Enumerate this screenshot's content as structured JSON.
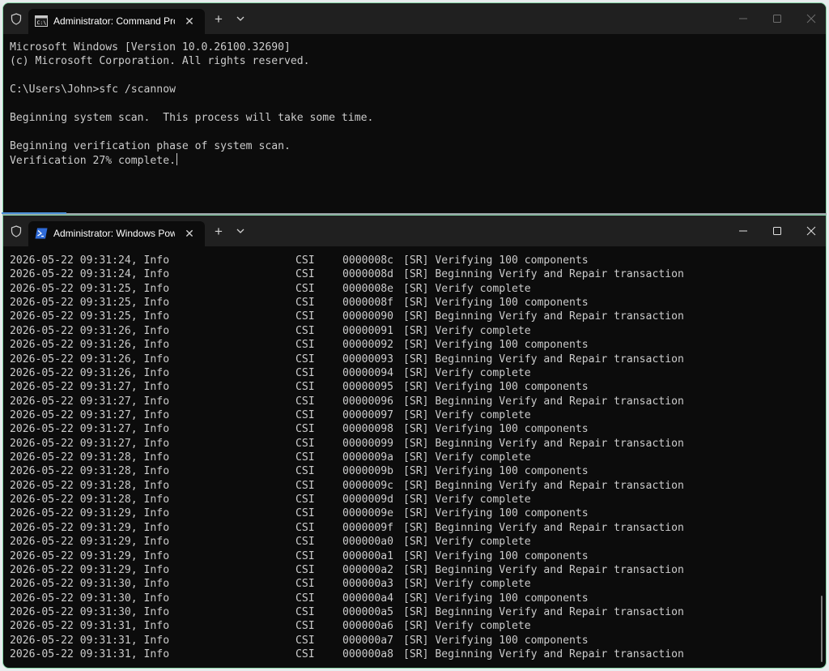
{
  "top_pane": {
    "tab_title": "Administrator: Command Prompt",
    "tab_icon": "command-prompt-icon",
    "lines": [
      "Microsoft Windows [Version 10.0.26100.32690]",
      "(c) Microsoft Corporation. All rights reserved.",
      "",
      "C:\\Users\\John>sfc /scannow",
      "",
      "Beginning system scan.  This process will take some time.",
      "",
      "Beginning verification phase of system scan."
    ],
    "last_line": "Verification 27% complete."
  },
  "bottom_pane": {
    "tab_title": "Administrator: Windows PowerShell",
    "tab_icon": "powershell-icon",
    "log_rows": [
      {
        "time": "2026-05-22 09:31:24, Info",
        "component": "CSI",
        "id": "0000008c",
        "message": "[SR] Verifying 100 components"
      },
      {
        "time": "2026-05-22 09:31:24, Info",
        "component": "CSI",
        "id": "0000008d",
        "message": "[SR] Beginning Verify and Repair transaction"
      },
      {
        "time": "2026-05-22 09:31:25, Info",
        "component": "CSI",
        "id": "0000008e",
        "message": "[SR] Verify complete"
      },
      {
        "time": "2026-05-22 09:31:25, Info",
        "component": "CSI",
        "id": "0000008f",
        "message": "[SR] Verifying 100 components"
      },
      {
        "time": "2026-05-22 09:31:25, Info",
        "component": "CSI",
        "id": "00000090",
        "message": "[SR] Beginning Verify and Repair transaction"
      },
      {
        "time": "2026-05-22 09:31:26, Info",
        "component": "CSI",
        "id": "00000091",
        "message": "[SR] Verify complete"
      },
      {
        "time": "2026-05-22 09:31:26, Info",
        "component": "CSI",
        "id": "00000092",
        "message": "[SR] Verifying 100 components"
      },
      {
        "time": "2026-05-22 09:31:26, Info",
        "component": "CSI",
        "id": "00000093",
        "message": "[SR] Beginning Verify and Repair transaction"
      },
      {
        "time": "2026-05-22 09:31:26, Info",
        "component": "CSI",
        "id": "00000094",
        "message": "[SR] Verify complete"
      },
      {
        "time": "2026-05-22 09:31:27, Info",
        "component": "CSI",
        "id": "00000095",
        "message": "[SR] Verifying 100 components"
      },
      {
        "time": "2026-05-22 09:31:27, Info",
        "component": "CSI",
        "id": "00000096",
        "message": "[SR] Beginning Verify and Repair transaction"
      },
      {
        "time": "2026-05-22 09:31:27, Info",
        "component": "CSI",
        "id": "00000097",
        "message": "[SR] Verify complete"
      },
      {
        "time": "2026-05-22 09:31:27, Info",
        "component": "CSI",
        "id": "00000098",
        "message": "[SR] Verifying 100 components"
      },
      {
        "time": "2026-05-22 09:31:27, Info",
        "component": "CSI",
        "id": "00000099",
        "message": "[SR] Beginning Verify and Repair transaction"
      },
      {
        "time": "2026-05-22 09:31:28, Info",
        "component": "CSI",
        "id": "0000009a",
        "message": "[SR] Verify complete"
      },
      {
        "time": "2026-05-22 09:31:28, Info",
        "component": "CSI",
        "id": "0000009b",
        "message": "[SR] Verifying 100 components"
      },
      {
        "time": "2026-05-22 09:31:28, Info",
        "component": "CSI",
        "id": "0000009c",
        "message": "[SR] Beginning Verify and Repair transaction"
      },
      {
        "time": "2026-05-22 09:31:28, Info",
        "component": "CSI",
        "id": "0000009d",
        "message": "[SR] Verify complete"
      },
      {
        "time": "2026-05-22 09:31:29, Info",
        "component": "CSI",
        "id": "0000009e",
        "message": "[SR] Verifying 100 components"
      },
      {
        "time": "2026-05-22 09:31:29, Info",
        "component": "CSI",
        "id": "0000009f",
        "message": "[SR] Beginning Verify and Repair transaction"
      },
      {
        "time": "2026-05-22 09:31:29, Info",
        "component": "CSI",
        "id": "000000a0",
        "message": "[SR] Verify complete"
      },
      {
        "time": "2026-05-22 09:31:29, Info",
        "component": "CSI",
        "id": "000000a1",
        "message": "[SR] Verifying 100 components"
      },
      {
        "time": "2026-05-22 09:31:29, Info",
        "component": "CSI",
        "id": "000000a2",
        "message": "[SR] Beginning Verify and Repair transaction"
      },
      {
        "time": "2026-05-22 09:31:30, Info",
        "component": "CSI",
        "id": "000000a3",
        "message": "[SR] Verify complete"
      },
      {
        "time": "2026-05-22 09:31:30, Info",
        "component": "CSI",
        "id": "000000a4",
        "message": "[SR] Verifying 100 components"
      },
      {
        "time": "2026-05-22 09:31:30, Info",
        "component": "CSI",
        "id": "000000a5",
        "message": "[SR] Beginning Verify and Repair transaction"
      },
      {
        "time": "2026-05-22 09:31:31, Info",
        "component": "CSI",
        "id": "000000a6",
        "message": "[SR] Verify complete"
      },
      {
        "time": "2026-05-22 09:31:31, Info",
        "component": "CSI",
        "id": "000000a7",
        "message": "[SR] Verifying 100 components"
      },
      {
        "time": "2026-05-22 09:31:31, Info",
        "component": "CSI",
        "id": "000000a8",
        "message": "[SR] Beginning Verify and Repair transaction"
      }
    ]
  },
  "window_controls": {
    "new_tab": "+",
    "close_tab": "✕"
  },
  "colors": {
    "terminal_bg": "#0c0c0c",
    "titlebar_bg": "#202020",
    "text": "#cccccc",
    "window_border": "#86d4a6",
    "powershell_blue": "#2f6bd8"
  }
}
